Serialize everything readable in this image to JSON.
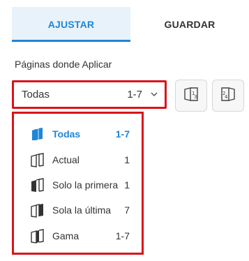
{
  "tabs": [
    {
      "label": "AJUSTAR",
      "active": true
    },
    {
      "label": "GUARDAR",
      "active": false
    }
  ],
  "pages_section": {
    "label": "Páginas donde Aplicar",
    "select": {
      "value": "Todas",
      "range": "1-7",
      "icon": "chevron-down-icon"
    },
    "buttons": [
      {
        "icon": "odd-pages-icon",
        "glyph": "13"
      },
      {
        "icon": "even-pages-icon",
        "glyph": "24"
      }
    ]
  },
  "dropdown": {
    "options": [
      {
        "label": "Todas",
        "count": "1-7",
        "selected": true,
        "icon": "stack-all-icon"
      },
      {
        "label": "Actual",
        "count": "1",
        "selected": false,
        "icon": "stack-current-icon"
      },
      {
        "label": "Solo la primera",
        "count": "1",
        "selected": false,
        "icon": "stack-first-icon"
      },
      {
        "label": "Sola la última",
        "count": "7",
        "selected": false,
        "icon": "stack-last-icon"
      },
      {
        "label": "Gama",
        "count": "1-7",
        "selected": false,
        "icon": "stack-range-icon"
      }
    ]
  },
  "colors": {
    "accent": "#1f86d6",
    "highlight_border": "#d9141a",
    "active_tab_bg": "#e8f2fb"
  }
}
